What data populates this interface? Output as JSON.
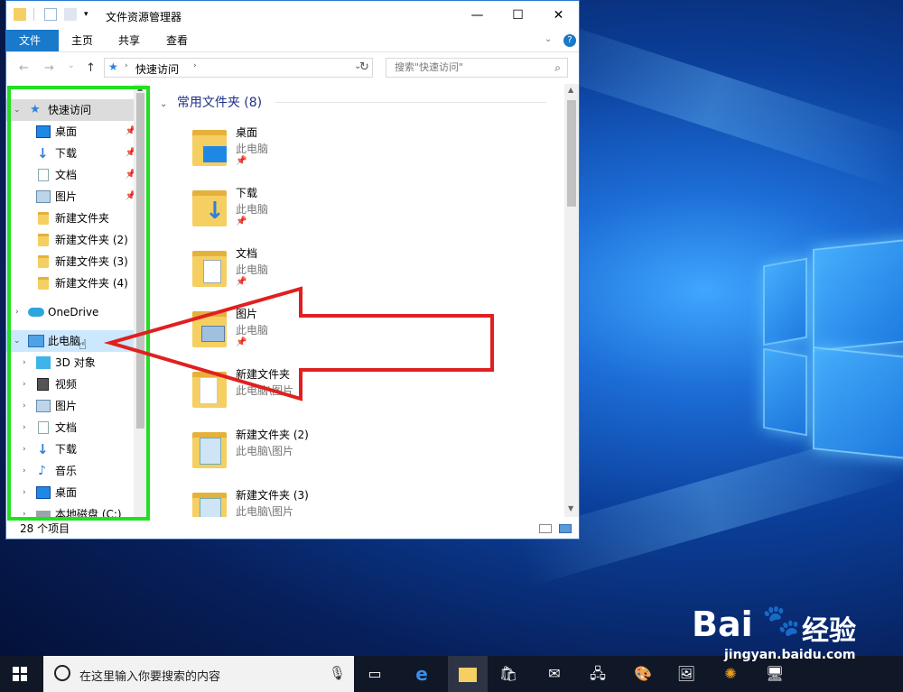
{
  "window": {
    "title": "文件资源管理器",
    "min": "—",
    "max": "☐",
    "close": "✕"
  },
  "ribbon": {
    "tabs": [
      "文件",
      "主页",
      "共享",
      "查看"
    ],
    "help": "?"
  },
  "address": {
    "path": "快速访问",
    "search_placeholder": "搜索\"快速访问\""
  },
  "nav": {
    "quick_access": "快速访问",
    "quick_items": [
      {
        "label": "桌面",
        "icon": "desktop-icon"
      },
      {
        "label": "下载",
        "icon": "download-arrow-icon"
      },
      {
        "label": "文档",
        "icon": "document-icon"
      },
      {
        "label": "图片",
        "icon": "pictures-icon"
      },
      {
        "label": "新建文件夹",
        "icon": "folder-icon"
      },
      {
        "label": "新建文件夹 (2)",
        "icon": "folder-icon"
      },
      {
        "label": "新建文件夹 (3)",
        "icon": "folder-icon"
      },
      {
        "label": "新建文件夹 (4)",
        "icon": "folder-icon"
      }
    ],
    "onedrive": "OneDrive",
    "this_pc": "此电脑",
    "pc_items": [
      {
        "label": "3D 对象",
        "icon": "3d-objects-icon"
      },
      {
        "label": "视频",
        "icon": "video-icon"
      },
      {
        "label": "图片",
        "icon": "pictures-icon"
      },
      {
        "label": "文档",
        "icon": "document-icon"
      },
      {
        "label": "下载",
        "icon": "download-arrow-icon"
      },
      {
        "label": "音乐",
        "icon": "music-icon"
      },
      {
        "label": "桌面",
        "icon": "desktop-icon"
      },
      {
        "label": "本地磁盘 (C:)",
        "icon": "drive-icon"
      }
    ]
  },
  "content": {
    "group_header": "常用文件夹 (8)",
    "tiles": [
      {
        "name": "桌面",
        "sub": "此电脑",
        "pinned": true
      },
      {
        "name": "下载",
        "sub": "此电脑",
        "pinned": true
      },
      {
        "name": "文档",
        "sub": "此电脑",
        "pinned": true
      },
      {
        "name": "图片",
        "sub": "此电脑",
        "pinned": true
      },
      {
        "name": "新建文件夹",
        "sub": "此电脑\\图片",
        "pinned": false
      },
      {
        "name": "新建文件夹 (2)",
        "sub": "此电脑\\图片",
        "pinned": false
      },
      {
        "name": "新建文件夹 (3)",
        "sub": "此电脑\\图片",
        "pinned": false
      }
    ]
  },
  "status": {
    "count": "28 个项目"
  },
  "taskbar": {
    "search_text": "在这里输入你要搜索的内容"
  },
  "watermark": {
    "brand": "Bai",
    "brand2": "经验",
    "url": "jingyan.baidu.com"
  },
  "colors": {
    "accent": "#1979ca",
    "highlight": "#21e021",
    "arrow": "#e02020"
  }
}
